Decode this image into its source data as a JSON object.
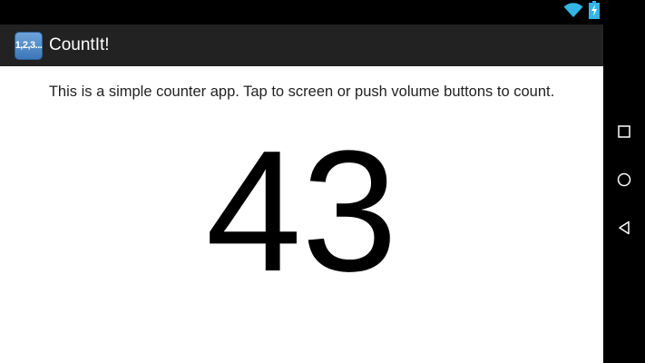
{
  "app": {
    "icon_text": "1,2,3...",
    "title": "CountIt!"
  },
  "main": {
    "instructions": "This is a simple counter app. Tap to screen or push volume buttons to count.",
    "count": "43"
  },
  "colors": {
    "action_bar": "#222222",
    "app_icon": "#4a86c8",
    "background": "#ffffff",
    "status_accent": "#33b5e5"
  },
  "icons": {
    "wifi": "wifi-icon",
    "battery": "battery-charging-icon",
    "recents": "recents-icon",
    "home": "home-icon",
    "back": "back-icon"
  }
}
